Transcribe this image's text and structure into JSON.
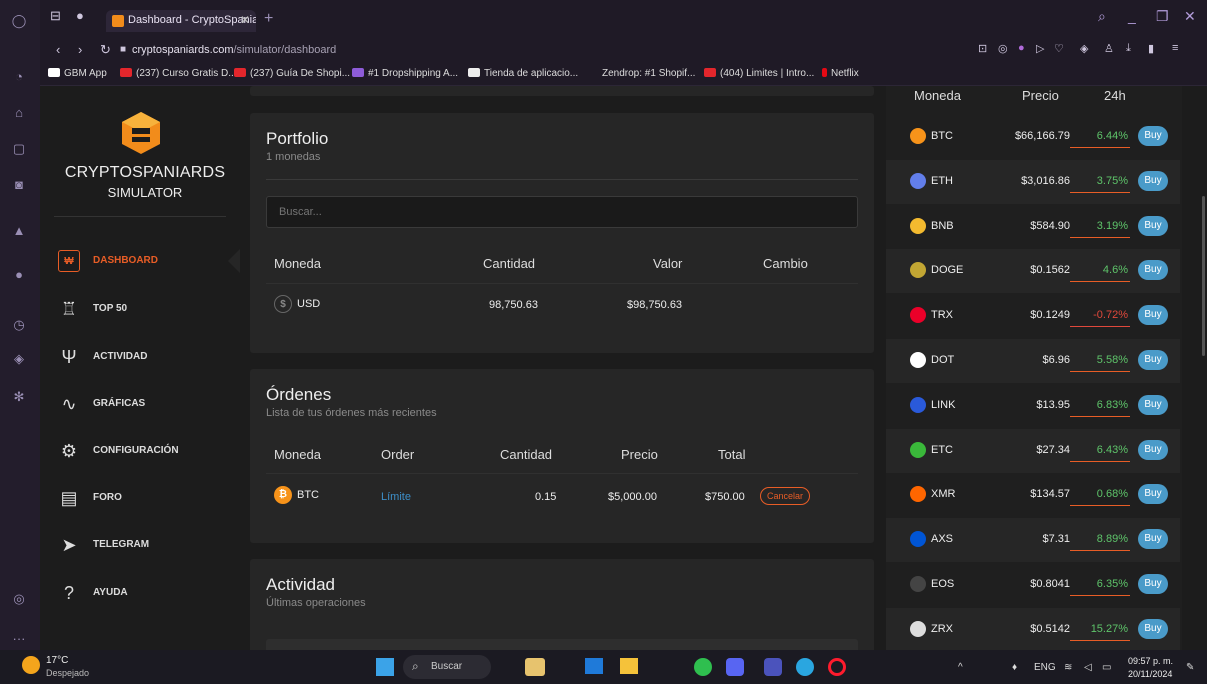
{
  "browser": {
    "tab_title": "Dashboard - CryptoSpaniar",
    "url_host": "cryptospaniards.com",
    "url_path": "/simulator/dashboard",
    "bookmarks": [
      "GBM App",
      "(237) Curso Gratis D...",
      "(237) Guía De Shopi...",
      "#1 Dropshipping A...",
      "Tienda de aplicacio...",
      "Zendrop: #1 Shopif...",
      "(404) Limites | Intro...",
      "Netflix"
    ]
  },
  "sidebar": {
    "brand_line1": "CRYPTOSPANIARDS",
    "brand_line2": "SIMULATOR",
    "items": [
      {
        "label": "DASHBOARD",
        "icon": "dashboard-icon"
      },
      {
        "label": "TOP 50",
        "icon": "trophy-icon"
      },
      {
        "label": "ACTIVIDAD",
        "icon": "broadcast-icon"
      },
      {
        "label": "GRÁFICAS",
        "icon": "pulse-icon"
      },
      {
        "label": "CONFIGURACIÓN",
        "icon": "gear-icon"
      },
      {
        "label": "FORO",
        "icon": "chat-icon"
      },
      {
        "label": "TELEGRAM",
        "icon": "send-icon"
      },
      {
        "label": "AYUDA",
        "icon": "question-icon"
      }
    ]
  },
  "portfolio": {
    "title": "Portfolio",
    "subtitle": "1 monedas",
    "search_placeholder": "Buscar...",
    "headers": [
      "Moneda",
      "Cantidad",
      "Valor",
      "Cambio"
    ],
    "rows": [
      {
        "coin": "USD",
        "cantidad": "98,750.63",
        "valor": "$98,750.63",
        "cambio": ""
      }
    ]
  },
  "orders": {
    "title": "Órdenes",
    "subtitle": "Lista de tus órdenes más recientes",
    "headers": [
      "Moneda",
      "Order",
      "Cantidad",
      "Precio",
      "Total"
    ],
    "rows": [
      {
        "coin": "BTC",
        "order": "Límite",
        "cantidad": "0.15",
        "precio": "$5,000.00",
        "total": "$750.00",
        "action": "Cancelar"
      }
    ]
  },
  "activity": {
    "title": "Actividad",
    "subtitle": "Últimas operaciones"
  },
  "market": {
    "headers": [
      "Moneda",
      "Precio",
      "24h"
    ],
    "buy_label": "Buy",
    "rows": [
      {
        "name": "BTC",
        "price": "$66,166.79",
        "change": "6.44%",
        "color": "#f7931a"
      },
      {
        "name": "ETH",
        "price": "$3,016.86",
        "change": "3.75%",
        "color": "#627eea"
      },
      {
        "name": "BNB",
        "price": "$584.90",
        "change": "3.19%",
        "color": "#f3ba2f"
      },
      {
        "name": "DOGE",
        "price": "$0.1562",
        "change": "4.6%",
        "color": "#c2a633"
      },
      {
        "name": "TRX",
        "price": "$0.1249",
        "change": "-0.72%",
        "color": "#eb0029"
      },
      {
        "name": "DOT",
        "price": "$6.96",
        "change": "5.58%",
        "color": "#ffffff"
      },
      {
        "name": "LINK",
        "price": "$13.95",
        "change": "6.83%",
        "color": "#2a5ada"
      },
      {
        "name": "ETC",
        "price": "$27.34",
        "change": "6.43%",
        "color": "#3ab83a"
      },
      {
        "name": "XMR",
        "price": "$134.57",
        "change": "0.68%",
        "color": "#ff6600"
      },
      {
        "name": "AXS",
        "price": "$7.31",
        "change": "8.89%",
        "color": "#0055d5"
      },
      {
        "name": "EOS",
        "price": "$0.8041",
        "change": "6.35%",
        "color": "#444444"
      },
      {
        "name": "ZRX",
        "price": "$0.5142",
        "change": "15.27%",
        "color": "#dddddd"
      }
    ]
  },
  "taskbar": {
    "weather_temp": "17°C",
    "weather_desc": "Despejado",
    "search_label": "Buscar",
    "lang": "ENG",
    "time": "09:57 p. m.",
    "date": "20/11/2024"
  },
  "colors": {
    "accent": "#e85d26",
    "buy": "#4a9bc9",
    "positive": "#5ec46a",
    "negative": "#e0483b"
  }
}
